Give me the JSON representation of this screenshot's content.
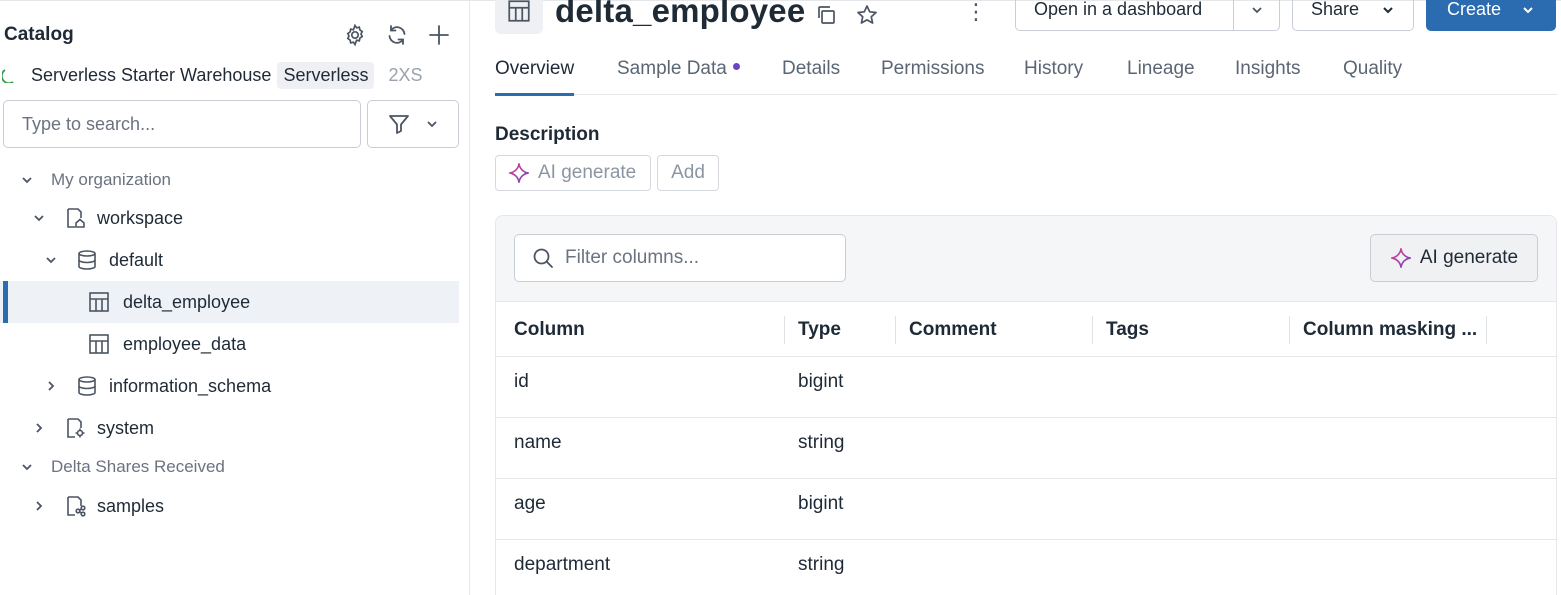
{
  "sidebar": {
    "title": "Catalog",
    "action_icons": [
      "gear-icon",
      "refresh-icon",
      "plus-icon"
    ],
    "warehouse": {
      "name": "Serverless Starter Warehouse",
      "badge": "Serverless",
      "size": "2XS",
      "status_color": "#2f9e44"
    },
    "search": {
      "placeholder": "Type to search...",
      "value": ""
    },
    "tree": {
      "my_org": "My organization",
      "workspace": "workspace",
      "default": "default",
      "delta_employee": "delta_employee",
      "employee_data": "employee_data",
      "information_schema": "information_schema",
      "system": "system",
      "shares": "Delta Shares Received",
      "samples": "samples"
    }
  },
  "header": {
    "title": "delta_employee",
    "open_dashboard": "Open in a dashboard",
    "share": "Share",
    "create": "Create"
  },
  "tabs": [
    "Overview",
    "Sample Data",
    "Details",
    "Permissions",
    "History",
    "Lineage",
    "Insights",
    "Quality"
  ],
  "description": {
    "label": "Description",
    "ai_generate": "AI generate",
    "add": "Add"
  },
  "columns_panel": {
    "filter_placeholder": "Filter columns...",
    "ai_generate": "AI generate",
    "headers": [
      "Column",
      "Type",
      "Comment",
      "Tags",
      "Column masking ..."
    ],
    "rows": [
      {
        "column": "id",
        "type": "bigint"
      },
      {
        "column": "name",
        "type": "string"
      },
      {
        "column": "age",
        "type": "bigint"
      },
      {
        "column": "department",
        "type": "string"
      }
    ]
  },
  "colors": {
    "accent": "#2b6cb0",
    "tab_dot": "#6b46c1",
    "selected_bg": "#eef2f7"
  }
}
